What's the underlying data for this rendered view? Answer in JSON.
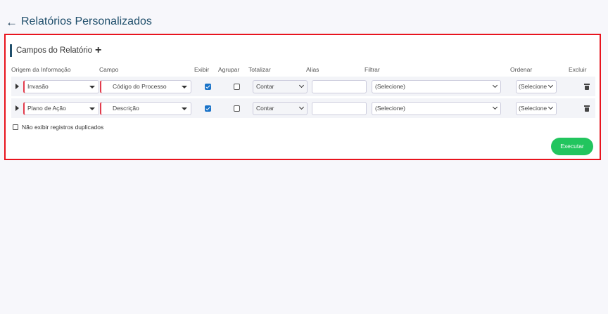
{
  "header": {
    "back_icon": "arrow-left-icon",
    "title": "Relatórios Personalizados"
  },
  "panel": {
    "section_title": "Campos do Relatório",
    "add_label": "+",
    "columns": {
      "origem": "Origem da Informação",
      "campo": "Campo",
      "exibir": "Exibir",
      "agrupar": "Agrupar",
      "totalizar": "Totalizar",
      "alias": "Alias",
      "filtrar": "Filtrar",
      "ordenar": "Ordenar",
      "excluir": "Excluir"
    },
    "rows": [
      {
        "origem": "Invasão",
        "campo": "Código do Processo",
        "exibir": true,
        "agrupar": false,
        "totalizar": "Contar",
        "alias": "",
        "filtrar": "(Selecione)",
        "ordenar": "(Selecione"
      },
      {
        "origem": "Plano de Ação",
        "campo": "Descrição",
        "exibir": true,
        "agrupar": false,
        "totalizar": "Contar",
        "alias": "",
        "filtrar": "(Selecione)",
        "ordenar": "(Selecione"
      }
    ],
    "no_duplicates_label": "Não exibir registros duplicados",
    "no_duplicates_checked": false,
    "run_label": "Executar"
  },
  "colors": {
    "accent": "#1f4e6b",
    "highlight_border": "#e8141e",
    "run_button": "#22c55e",
    "checkbox_on": "#1a73c8"
  }
}
